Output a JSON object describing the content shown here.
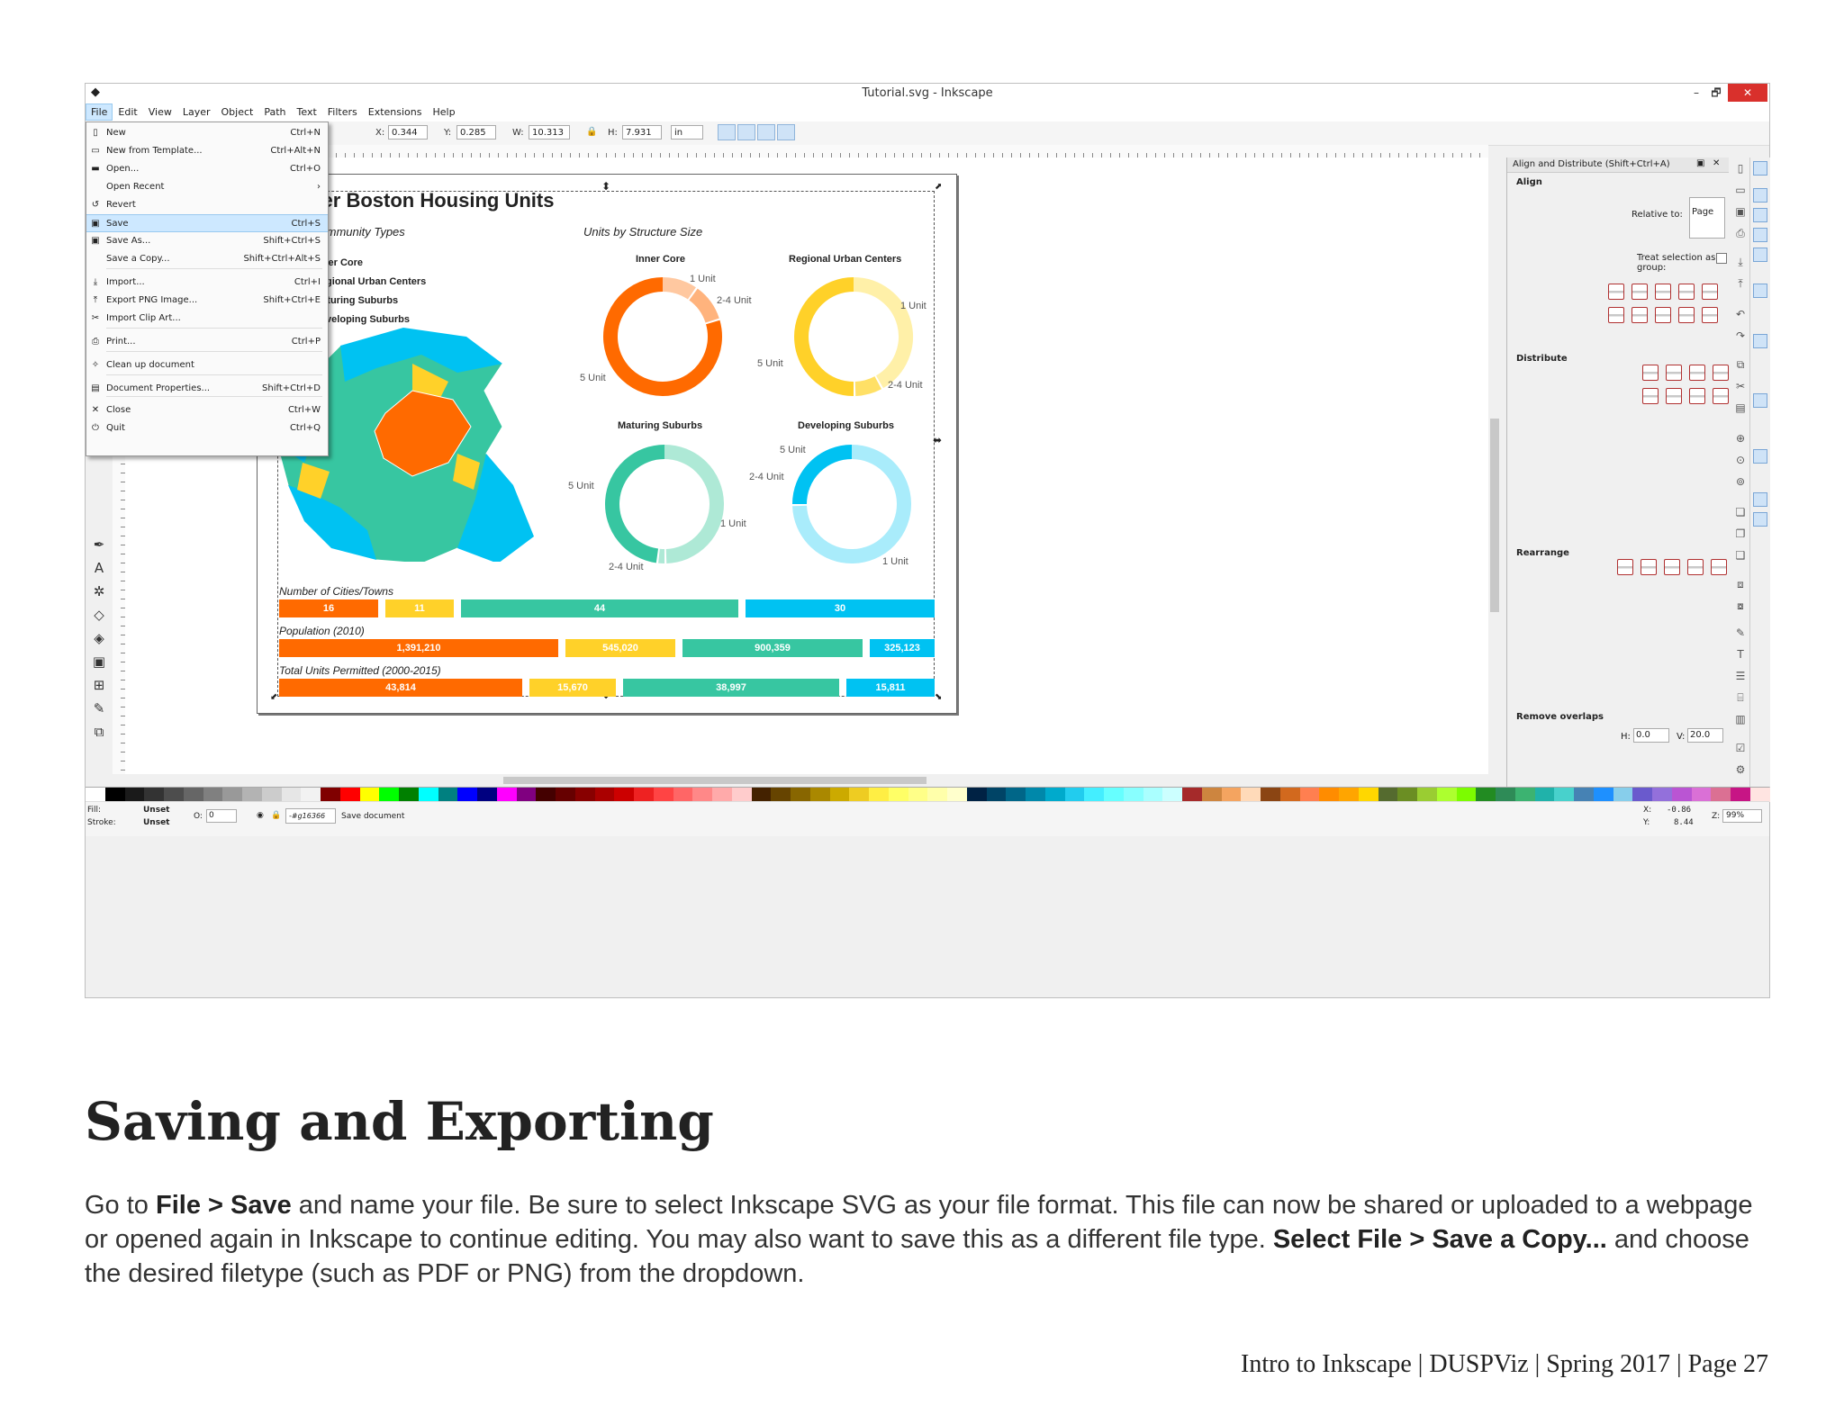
{
  "window": {
    "title": "Tutorial.svg - Inkscape",
    "buttons": [
      "–",
      "🗗",
      "✕"
    ]
  },
  "menubar": {
    "items": [
      "File",
      "Edit",
      "View",
      "Layer",
      "Object",
      "Path",
      "Text",
      "Filters",
      "Extensions",
      "Help"
    ]
  },
  "toolbar": {
    "x_label": "X:",
    "x_value": "0.344",
    "y_label": "Y:",
    "y_value": "0.285",
    "w_label": "W:",
    "w_value": "10.313",
    "h_label": "H:",
    "h_value": "7.931",
    "unit": "in"
  },
  "file_menu": {
    "items": [
      {
        "label": "New",
        "shortcut": "Ctrl+N",
        "icon": "new-document-icon"
      },
      {
        "label": "New from Template...",
        "shortcut": "Ctrl+Alt+N",
        "icon": "template-icon"
      },
      {
        "label": "Open...",
        "shortcut": "Ctrl+O",
        "icon": "folder-icon"
      },
      {
        "label": "Open Recent",
        "shortcut": "›",
        "icon": ""
      },
      {
        "label": "Revert",
        "shortcut": "",
        "icon": "revert-icon"
      },
      {
        "label": "Save",
        "shortcut": "Ctrl+S",
        "icon": "save-icon"
      },
      {
        "label": "Save As...",
        "shortcut": "Shift+Ctrl+S",
        "icon": "save-as-icon"
      },
      {
        "label": "Save a Copy...",
        "shortcut": "Shift+Ctrl+Alt+S",
        "icon": ""
      },
      {
        "label": "Import...",
        "shortcut": "Ctrl+I",
        "icon": "import-icon"
      },
      {
        "label": "Export PNG Image...",
        "shortcut": "Shift+Ctrl+E",
        "icon": "export-icon"
      },
      {
        "label": "Import Clip Art...",
        "shortcut": "",
        "icon": "clipart-icon"
      },
      {
        "label": "Print...",
        "shortcut": "Ctrl+P",
        "icon": "print-icon"
      },
      {
        "label": "Clean up document",
        "shortcut": "",
        "icon": "cleanup-icon"
      },
      {
        "label": "Document Properties...",
        "shortcut": "Shift+Ctrl+D",
        "icon": "properties-icon"
      },
      {
        "label": "Close",
        "shortcut": "Ctrl+W",
        "icon": "close-icon"
      },
      {
        "label": "Quit",
        "shortcut": "Ctrl+Q",
        "icon": "quit-icon"
      }
    ],
    "selected_index": 5
  },
  "infographic": {
    "title": "ater Boston Housing Units",
    "community_types_heading": "Community Types",
    "units_heading": "Units by Structure Size",
    "legend": [
      "Inner Core",
      "Regional Urban Centers",
      "Maturing Suburbs",
      "Developing Suburbs"
    ],
    "colors": {
      "inner": "#ff6a00",
      "regional": "#ffd129",
      "maturing": "#37c6a1",
      "developing": "#00c2f2",
      "inner_l": "#ffc8a0",
      "regional_l": "#fff0a8",
      "maturing_l": "#aee9d6",
      "developing_l": "#a9ecfb"
    },
    "donuts": [
      {
        "title": "Inner Core",
        "labels": [
          "1 Unit",
          "2-4 Unit",
          "5 Unit"
        ]
      },
      {
        "title": "Regional Urban Centers",
        "labels": [
          "1 Unit",
          "5 Unit",
          "2-4 Unit"
        ]
      },
      {
        "title": "Maturing Suburbs",
        "labels": [
          "5 Unit",
          "1 Unit",
          "2-4 Unit"
        ]
      },
      {
        "title": "Developing Suburbs",
        "labels": [
          "5 Unit",
          "2-4 Unit",
          "1 Unit"
        ]
      }
    ],
    "bar_groups": [
      {
        "label": "Number of Cities/Towns",
        "values": [
          "16",
          "11",
          "44",
          "30"
        ]
      },
      {
        "label": "Population (2010)",
        "values": [
          "1,391,210",
          "545,020",
          "900,359",
          "325,123"
        ]
      },
      {
        "label": "Total Units Permitted (2000-2015)",
        "values": [
          "43,814",
          "15,670",
          "38,997",
          "15,811"
        ]
      }
    ]
  },
  "dock": {
    "title": "Align and Distribute (Shift+Ctrl+A)",
    "align": "Align",
    "relative_to_label": "Relative to:",
    "relative_to_value": "Page",
    "treat_selection": "Treat selection as group:",
    "distribute": "Distribute",
    "rearrange": "Rearrange",
    "remove_overlaps": "Remove overlaps",
    "h_label": "H:",
    "h_value": "0.0",
    "v_label": "V:",
    "v_value": "20.0"
  },
  "statusbar": {
    "fill_label": "Fill:",
    "fill_value": "Unset",
    "stroke_label": "Stroke:",
    "stroke_value": "Unset",
    "opacity_label": "O:",
    "opacity_value": "0",
    "layer": "-#g16366",
    "message": "Save document",
    "x_label": "X:",
    "x_value": "-0.86",
    "y_label": "Y:",
    "y_value": "8.44",
    "zoom_label": "Z:",
    "zoom_value": "99%"
  },
  "doc": {
    "heading": "Saving and Exporting",
    "p1": "Go to ",
    "b1": "File > Save",
    "p2": " and name your file. Be sure to select Inkscape SVG as your file format. This file can now be shared or uploaded to a webpage or opened again in Inkscape to continue editing. You may also want to save this as a different file type. ",
    "b2": "Select File > Save a Copy...",
    "p3": " and choose the desired filetype (such as PDF or PNG) from the dropdown.",
    "footer": "Intro to Inkscape | DUSPViz | Spring 2017 | Page 27"
  }
}
